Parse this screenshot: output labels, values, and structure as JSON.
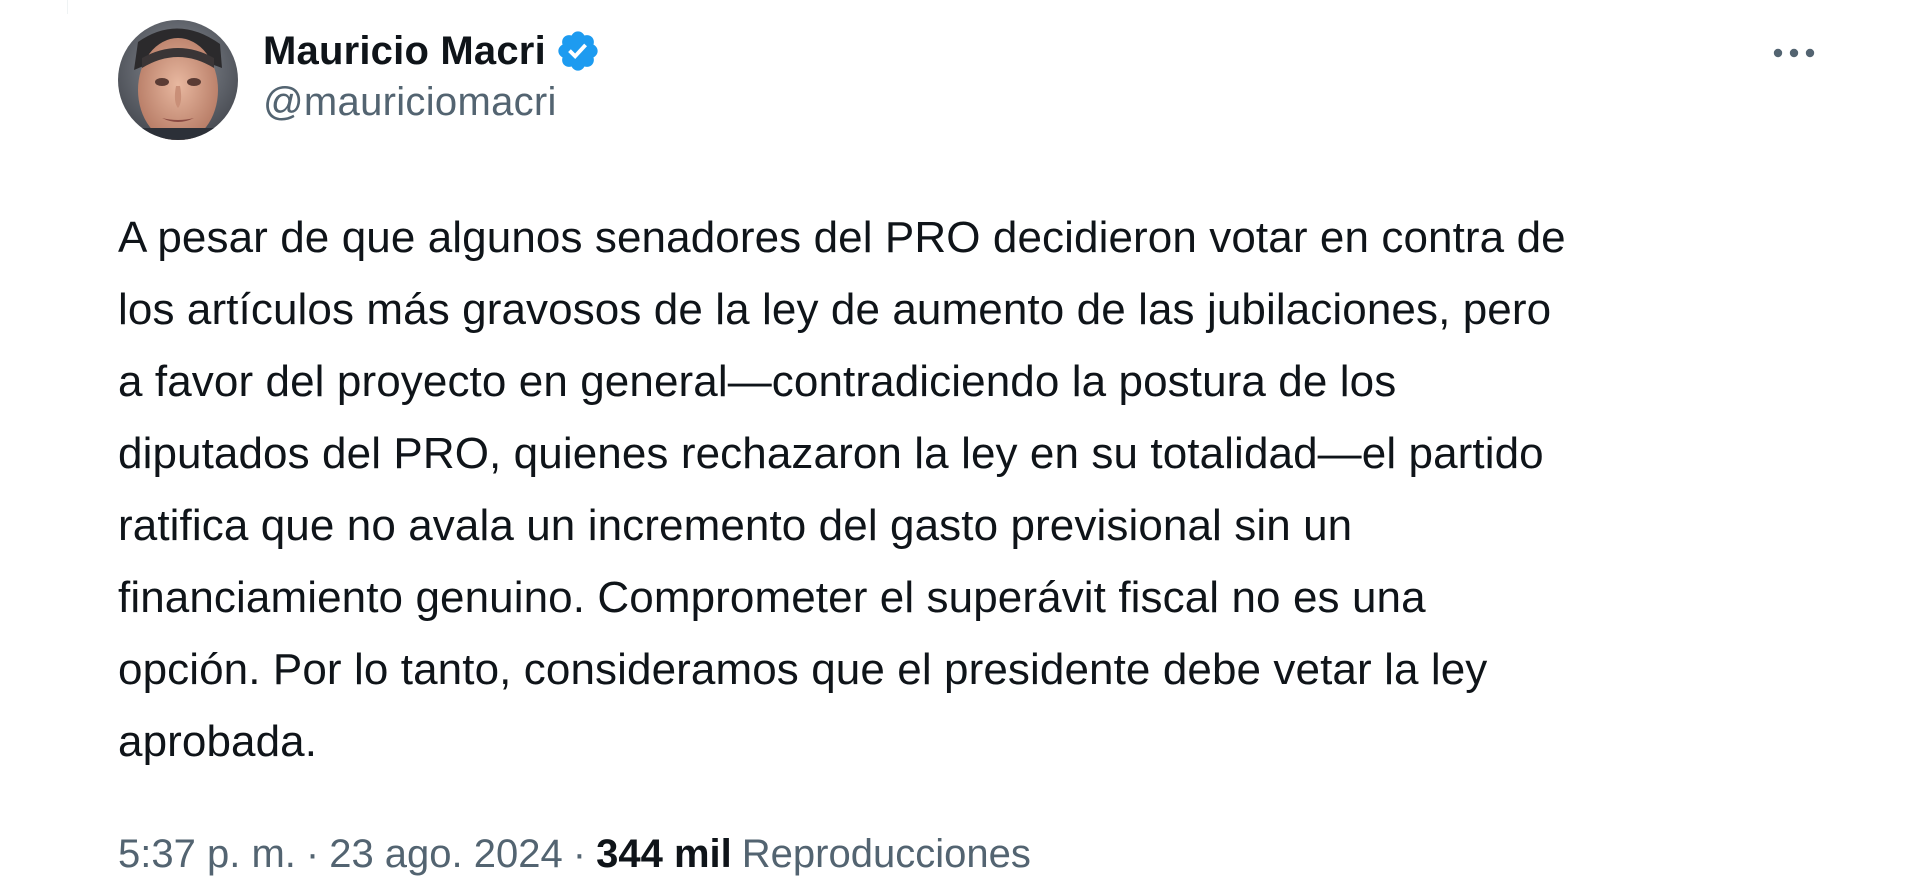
{
  "tweet": {
    "author": {
      "display_name": "Mauricio Macri",
      "handle": "@mauriciomacri",
      "verified": true,
      "avatar_icon": "profile-photo"
    },
    "menu_icon": "more-horizontal-icon",
    "text": "A pesar de que algunos senadores del PRO decidieron votar en contra de\nlos artículos más gravosos de la ley de aumento de las jubilaciones, pero\na favor del proyecto en general—contradiciendo la postura de los\ndiputados del PRO, quienes rechazaron la ley en su totalidad—el partido\nratifica que no avala un incremento del gasto previsional sin un\nfinanciamiento genuino. Comprometer el superávit fiscal no es una\nopción. Por lo tanto, consideramos que el presidente debe vetar la ley\naprobada.",
    "meta": {
      "time": "5:37 p. m.",
      "separator": "·",
      "date": "23 ago. 2024",
      "views_count": "344 mil",
      "views_label": "Reproducciones"
    }
  },
  "colors": {
    "text_primary": "#0f1419",
    "text_secondary": "#536471",
    "verified_blue": "#1d9bf0"
  }
}
